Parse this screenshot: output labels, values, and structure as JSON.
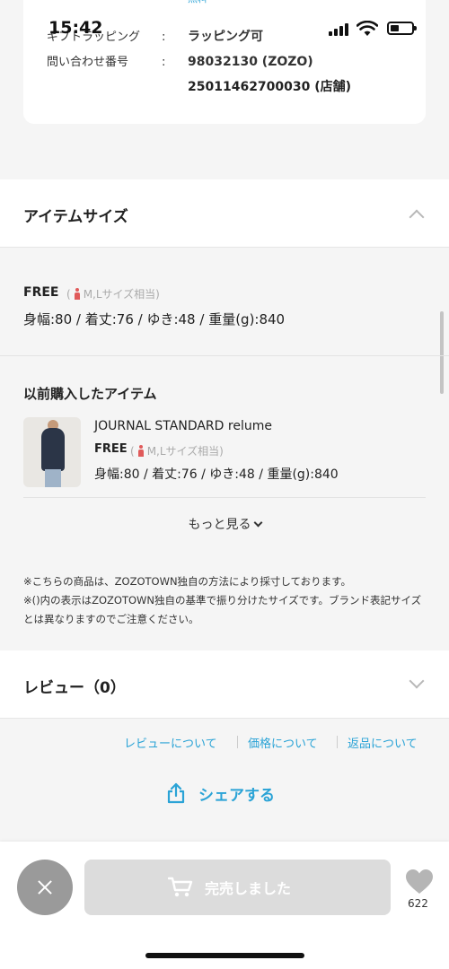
{
  "status_bar": {
    "time": "15:42"
  },
  "info": {
    "cut_off_text": "無料",
    "gift_label": "ギフトラッピング",
    "colon": ":",
    "gift_value": "ラッピング可",
    "inquiry_label": "問い合わせ番号",
    "inquiry_value_1": "98032130 (ZOZO)",
    "inquiry_value_2": "25011462700030 (店舗)"
  },
  "item_size": {
    "title": "アイテムサイズ",
    "size_name": "FREE",
    "note_open": "(",
    "note_text": "M,Lサイズ相当)",
    "dims": "身幅:80 / 着丈:76 / ゆき:48 / 重量(g):840"
  },
  "previous": {
    "title": "以前購入したアイテム",
    "brand": "JOURNAL STANDARD relume",
    "size_name": "FREE",
    "note_open": "(",
    "note_text": "M,Lサイズ相当)",
    "dims": "身幅:80 / 着丈:76 / ゆき:48 / 重量(g):840",
    "more_label": "もっと見る"
  },
  "notes": {
    "line1": "※こちらの商品は、ZOZOTOWN独自の方法により採寸しております。",
    "line2": "※()内の表示はZOZOTOWN独自の基準で振り分けたサイズです。ブランド表記サイズとは異なりますのでご注意ください。"
  },
  "review": {
    "title": "レビュー（0）"
  },
  "links": {
    "review_about": "レビューについて",
    "price_about": "価格について",
    "return_about": "返品について"
  },
  "share": {
    "label": "シェアする"
  },
  "bottom": {
    "soldout_label": "完売しました",
    "like_count": "622"
  },
  "colors": {
    "accent": "#2aa3d6",
    "person_icon": "#e05a5a",
    "disabled_button": "#dcdcdc",
    "close_button": "#9a9a9a",
    "heart": "#b5b5b5"
  }
}
